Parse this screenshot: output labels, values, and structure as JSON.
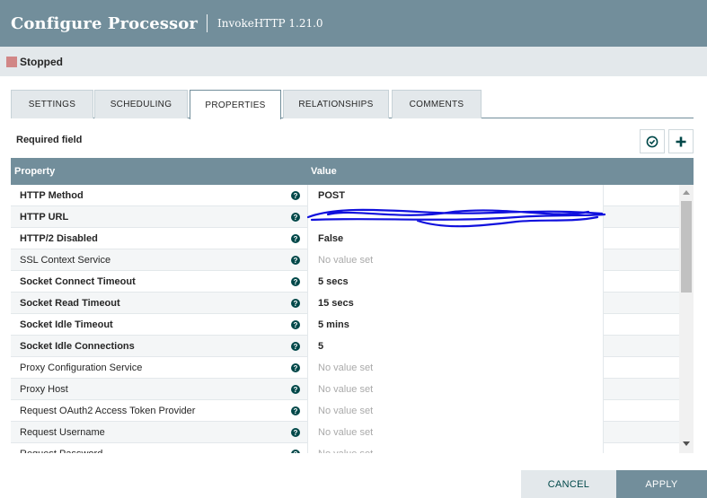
{
  "dialog": {
    "title": "Configure Processor",
    "subtitle": "InvokeHTTP 1.21.0"
  },
  "status": {
    "label": "Stopped",
    "color": "#d18686"
  },
  "tabs": [
    {
      "label": "SETTINGS",
      "active": false
    },
    {
      "label": "SCHEDULING",
      "active": false
    },
    {
      "label": "PROPERTIES",
      "active": true
    },
    {
      "label": "RELATIONSHIPS",
      "active": false
    },
    {
      "label": "COMMENTS",
      "active": false
    }
  ],
  "properties_panel": {
    "required_label": "Required field",
    "verify_icon": "check-circle-icon",
    "add_icon": "plus-icon",
    "columns": {
      "property": "Property",
      "value": "Value"
    },
    "rows": [
      {
        "name": "HTTP Method",
        "value": "POST",
        "required": true
      },
      {
        "name": "HTTP URL",
        "value": "",
        "required": true,
        "redacted": true
      },
      {
        "name": "HTTP/2 Disabled",
        "value": "False",
        "required": true
      },
      {
        "name": "SSL Context Service",
        "value": "No value set",
        "required": false
      },
      {
        "name": "Socket Connect Timeout",
        "value": "5 secs",
        "required": true
      },
      {
        "name": "Socket Read Timeout",
        "value": "15 secs",
        "required": true
      },
      {
        "name": "Socket Idle Timeout",
        "value": "5 mins",
        "required": true
      },
      {
        "name": "Socket Idle Connections",
        "value": "5",
        "required": true
      },
      {
        "name": "Proxy Configuration Service",
        "value": "No value set",
        "required": false
      },
      {
        "name": "Proxy Host",
        "value": "No value set",
        "required": false
      },
      {
        "name": "Request OAuth2 Access Token Provider",
        "value": "No value set",
        "required": false
      },
      {
        "name": "Request Username",
        "value": "No value set",
        "required": false
      },
      {
        "name": "Request Password",
        "value": "No value set",
        "required": false
      }
    ],
    "help_glyph": "?"
  },
  "footer": {
    "cancel_label": "CANCEL",
    "apply_label": "APPLY"
  },
  "colors": {
    "header": "#728e9b",
    "accent": "#004849",
    "redaction": "#1010dd"
  }
}
